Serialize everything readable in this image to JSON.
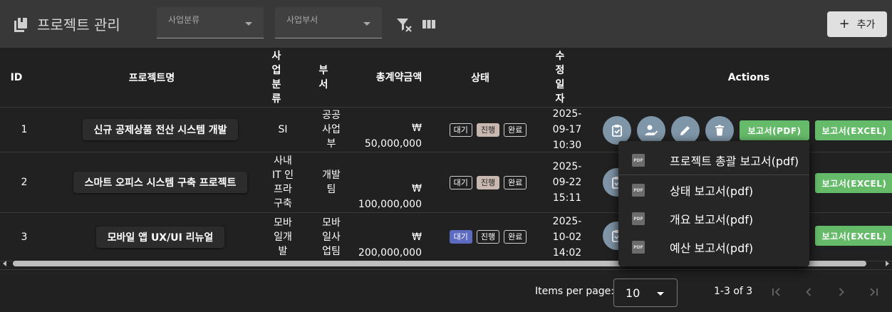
{
  "toolbar": {
    "title": "프로젝트 관리",
    "filter_category_label": "사업분류",
    "filter_department_label": "사업부서",
    "add_label": "추가"
  },
  "table": {
    "headers": {
      "id": "ID",
      "name": "프로젝트명",
      "category": "사업분류",
      "department": "부서",
      "amount": "총계약금액",
      "status": "상태",
      "modified": "수정일자",
      "actions": "Actions"
    },
    "status_options": [
      "대기",
      "진행",
      "완료"
    ],
    "rows": [
      {
        "id": "1",
        "name": "신규 공제상품 전산 시스템 개발",
        "category": "SI",
        "department": "공공사업부",
        "currency": "₩",
        "amount": "50,000,000",
        "status": "진행",
        "date": "2025-09-17",
        "time": "10:30"
      },
      {
        "id": "2",
        "name": "스마트 오피스 시스템 구축 프로젝트",
        "category": "사내 IT 인프라 구축",
        "department": "개발팀",
        "currency": "₩",
        "amount": "100,000,000",
        "status": "진행",
        "date": "2025-09-22",
        "time": "15:11"
      },
      {
        "id": "3",
        "name": "모바일 앱 UX/UI 리뉴얼",
        "category": "모바일개발",
        "department": "모바일사업팀",
        "currency": "₩",
        "amount": "200,000,000",
        "status": "대기",
        "date": "2025-10-02",
        "time": "14:02"
      }
    ],
    "report_pdf_label": "보고서(PDF)",
    "report_excel_label": "보고서(EXCEL)"
  },
  "menu": {
    "items": [
      {
        "icon": "PDF",
        "label": "프로젝트 총괄 보고서(pdf)"
      },
      {
        "icon": "PDF",
        "label": "상태 보고서(pdf)"
      },
      {
        "icon": "PDF",
        "label": "개요 보고서(pdf)"
      },
      {
        "icon": "PDF",
        "label": "예산 보고서(pdf)"
      }
    ]
  },
  "pagination": {
    "items_per_page_label": "Items per page:",
    "items_per_page": "10",
    "range": "1-3 of 3"
  },
  "colors": {
    "toolbar": "#383838",
    "background": "#212121",
    "action_round": "#7f96a8",
    "report_green": "#66bb6a",
    "status_progress": "#c8b8b0",
    "status_wait": "#5c6bc0"
  }
}
